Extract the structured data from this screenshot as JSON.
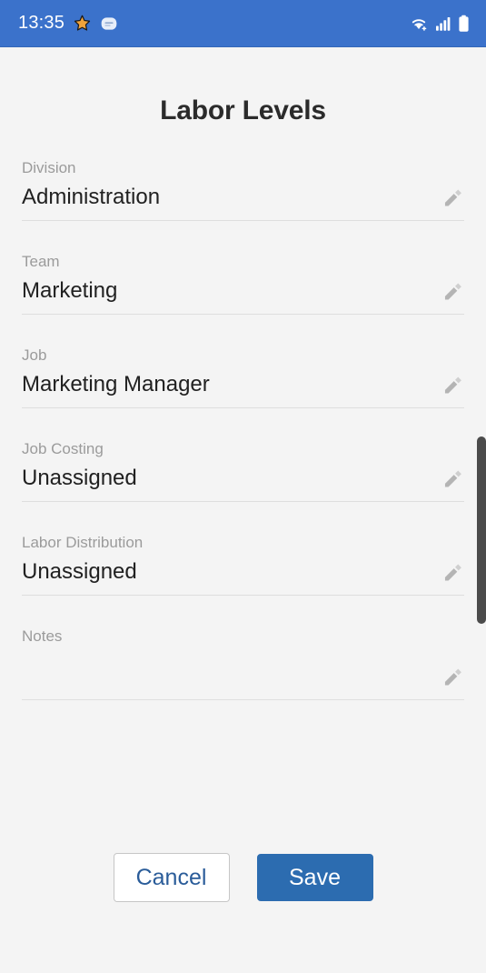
{
  "status_bar": {
    "time": "13:35",
    "background_color": "#3b72cb",
    "left_icons": [
      {
        "name": "star-notification-icon",
        "glyph": "★"
      },
      {
        "name": "app-badge-icon",
        "glyph": ""
      }
    ],
    "right_icons": [
      {
        "name": "wifi-icon"
      },
      {
        "name": "cellular-signal-icon"
      },
      {
        "name": "battery-icon"
      }
    ]
  },
  "screen": {
    "title": "Labor Levels",
    "background_color": "#f4f4f4"
  },
  "form": {
    "fields": [
      {
        "label": "Division",
        "value": "Administration",
        "edit_icon": "pencil-icon"
      },
      {
        "label": "Team",
        "value": "Marketing",
        "edit_icon": "pencil-icon"
      },
      {
        "label": "Job",
        "value": "Marketing Manager",
        "edit_icon": "pencil-icon"
      },
      {
        "label": "Job Costing",
        "value": "Unassigned",
        "edit_icon": "pencil-icon"
      },
      {
        "label": "Labor Distribution",
        "value": "Unassigned",
        "edit_icon": "pencil-icon"
      },
      {
        "label": "Notes",
        "value": "",
        "edit_icon": "pencil-icon"
      }
    ]
  },
  "actions": {
    "cancel_label": "Cancel",
    "save_label": "Save",
    "cancel_text_color": "#2a5c99",
    "save_background_color": "#2c6cb0"
  },
  "scrollbar": {
    "color": "#4b4b4b"
  }
}
